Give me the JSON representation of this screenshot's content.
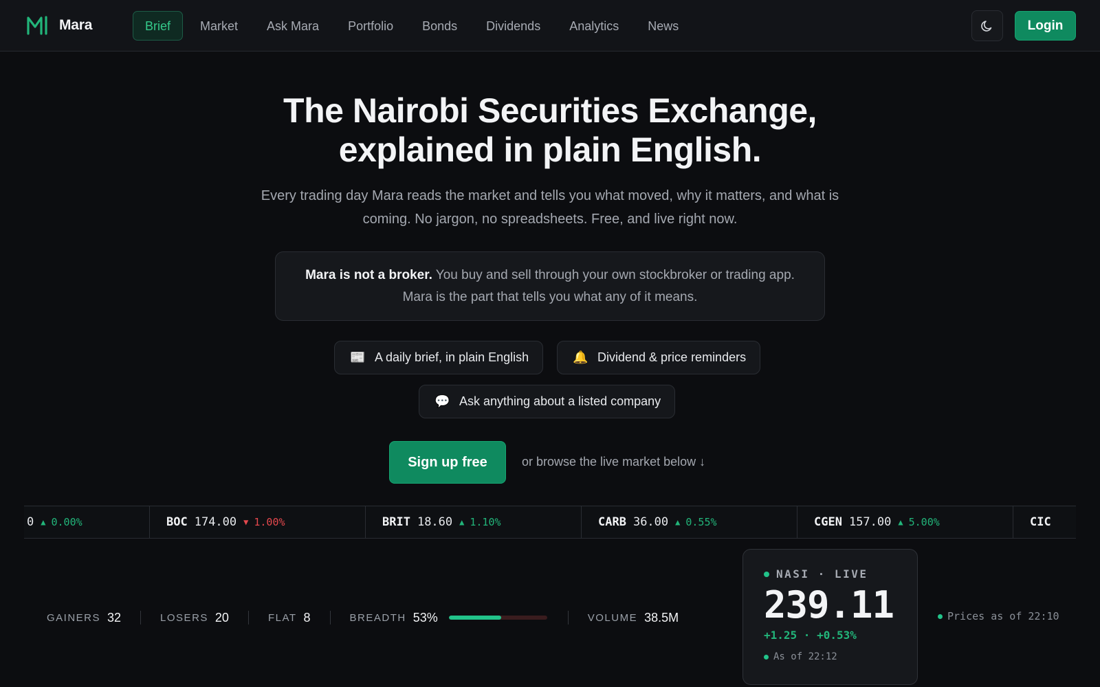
{
  "brand": {
    "name": "Mara",
    "logo_icon": "mara-logo-icon",
    "accent": "#34c98a"
  },
  "nav": {
    "items": [
      {
        "label": "Brief",
        "active": true
      },
      {
        "label": "Market",
        "active": false
      },
      {
        "label": "Ask Mara",
        "active": false
      },
      {
        "label": "Portfolio",
        "active": false
      },
      {
        "label": "Bonds",
        "active": false
      },
      {
        "label": "Dividends",
        "active": false
      },
      {
        "label": "Analytics",
        "active": false
      },
      {
        "label": "News",
        "active": false
      }
    ],
    "theme_icon": "moon-icon",
    "login_label": "Login"
  },
  "hero": {
    "title_line1": "The Nairobi Securities Exchange,",
    "title_line2": "explained in plain English.",
    "subtitle": "Every trading day Mara reads the market and tells you what moved, why it matters, and what is coming. No jargon, no spreadsheets. Free, and live right now."
  },
  "notice": {
    "bold": "Mara is not a broker.",
    "text": " You buy and sell through your own stockbroker or trading app. Mara is the part that tells you what any of it means."
  },
  "features": [
    {
      "icon": "newspaper-icon",
      "glyph": "📰",
      "label": "A daily brief, in plain English"
    },
    {
      "icon": "bell-icon",
      "glyph": "🔔",
      "label": "Dividend & price reminders"
    },
    {
      "icon": "speech-bubble-icon",
      "glyph": "💬",
      "label": "Ask anything about a listed company"
    }
  ],
  "cta": {
    "signup_label": "Sign up free",
    "browse_note": "or browse the live market below ↓"
  },
  "ticker": [
    {
      "symbol": "",
      "price": "0",
      "direction": "up",
      "change": "0.00%"
    },
    {
      "symbol": "BOC",
      "price": "174.00",
      "direction": "down",
      "change": "1.00%"
    },
    {
      "symbol": "BRIT",
      "price": "18.60",
      "direction": "up",
      "change": "1.10%"
    },
    {
      "symbol": "CARB",
      "price": "36.00",
      "direction": "up",
      "change": "0.55%"
    },
    {
      "symbol": "CGEN",
      "price": "157.00",
      "direction": "up",
      "change": "5.00%"
    },
    {
      "symbol": "CIC",
      "price": "",
      "direction": "",
      "change": ""
    }
  ],
  "stats": {
    "gainers_label": "GAINERS",
    "gainers": "32",
    "losers_label": "LOSERS",
    "losers": "20",
    "flat_label": "FLAT",
    "flat": "8",
    "breadth_label": "BREADTH",
    "breadth": "53%",
    "breadth_fraction": 0.53,
    "volume_label": "VOLUME",
    "volume": "38.5M"
  },
  "nasi": {
    "label": "NASI · LIVE",
    "value": "239.11",
    "change": "+1.25 · +0.53%",
    "as_of": "As of 22:12"
  },
  "prices_as_of": "Prices as of 22:10"
}
